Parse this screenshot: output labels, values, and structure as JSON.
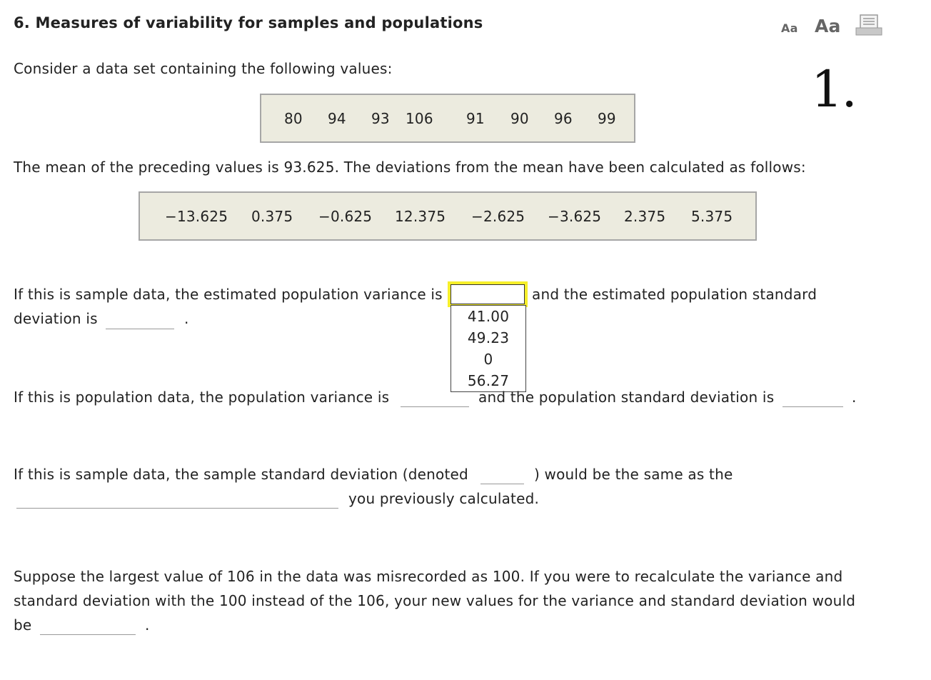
{
  "header": {
    "title": "6. Measures of variability for samples and populations",
    "font_small_label": "Aa",
    "font_large_label": "Aa",
    "print_icon": "print-icon",
    "question_number": "1."
  },
  "intro": "Consider a data set containing the following values:",
  "values": [
    "80",
    "94",
    "93",
    "106",
    "91",
    "90",
    "96",
    "99"
  ],
  "mean_sentence": "The mean of the preceding values is 93.625. The deviations from the mean have been calculated as follows:",
  "deviations": [
    "−13.625",
    "0.375",
    "−0.625",
    "12.375",
    "−2.625",
    "−3.625",
    "2.375",
    "5.375"
  ],
  "q1": {
    "before": "If this is sample data, the estimated population variance is",
    "after": "and the estimated population standard",
    "line2": "deviation is",
    "period": "."
  },
  "dropdown": {
    "selected": "",
    "options": [
      "41.00",
      "49.23",
      "0",
      "56.27"
    ]
  },
  "q2": {
    "before": "If this is population data, the population variance is",
    "after": "and the population standard deviation is",
    "period": "."
  },
  "q3": {
    "before": "If this is sample data, the sample standard deviation (denoted",
    "after": ") would be the same as the",
    "line2": "you previously calculated."
  },
  "q4": {
    "text": "Suppose the largest value of 106 in the data was misrecorded as 100. If you were to recalculate the variance and standard deviation with the 100 instead of the 106, your new values for the variance and standard deviation would",
    "line_end": "be",
    "period": "."
  },
  "colors": {
    "box_background": "#ecebdf",
    "focus_highlight": "#f6ef2a"
  }
}
